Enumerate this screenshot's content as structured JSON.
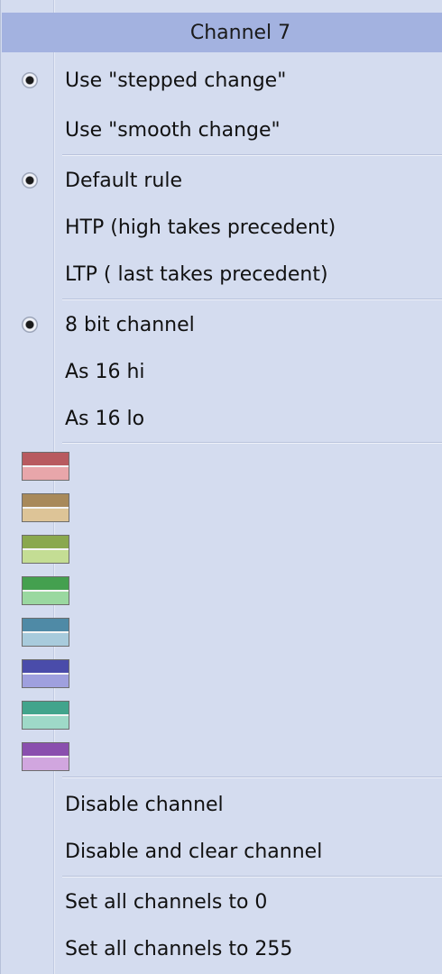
{
  "menu": {
    "title": "Channel 7",
    "groups": {
      "change_mode": [
        {
          "label": "Use \"stepped change\"",
          "selected": true
        },
        {
          "label": "Use \"smooth change\"",
          "selected": false
        }
      ],
      "rule": [
        {
          "label": "Default rule",
          "selected": true
        },
        {
          "label": "HTP (high takes precedent)",
          "selected": false
        },
        {
          "label": "LTP ( last takes precedent)",
          "selected": false
        }
      ],
      "bit_mode": [
        {
          "label": "8 bit channel",
          "selected": true
        },
        {
          "label": "As 16 hi",
          "selected": false
        },
        {
          "label": "As 16 lo",
          "selected": false
        }
      ]
    },
    "color_swatches": [
      {
        "name": "red",
        "top": "#b85a5f",
        "bottom": "#e8a6aa"
      },
      {
        "name": "tan",
        "top": "#a8895a",
        "bottom": "#ddc497"
      },
      {
        "name": "olive-green",
        "top": "#8aa84e",
        "bottom": "#c4dd94"
      },
      {
        "name": "green",
        "top": "#44a04f",
        "bottom": "#9ad8a0"
      },
      {
        "name": "steel-blue",
        "top": "#4f8aa6",
        "bottom": "#a8cbdc"
      },
      {
        "name": "indigo",
        "top": "#4a4caa",
        "bottom": "#9fa0de"
      },
      {
        "name": "teal",
        "top": "#42a48c",
        "bottom": "#9ed9c8"
      },
      {
        "name": "purple",
        "top": "#8a4fae",
        "bottom": "#d1a6df"
      }
    ],
    "actions": {
      "disable_channel": "Disable channel",
      "disable_and_clear": "Disable and clear channel",
      "set_all_zero": "Set all channels to 0",
      "set_all_255": "Set all channels to 255"
    }
  }
}
